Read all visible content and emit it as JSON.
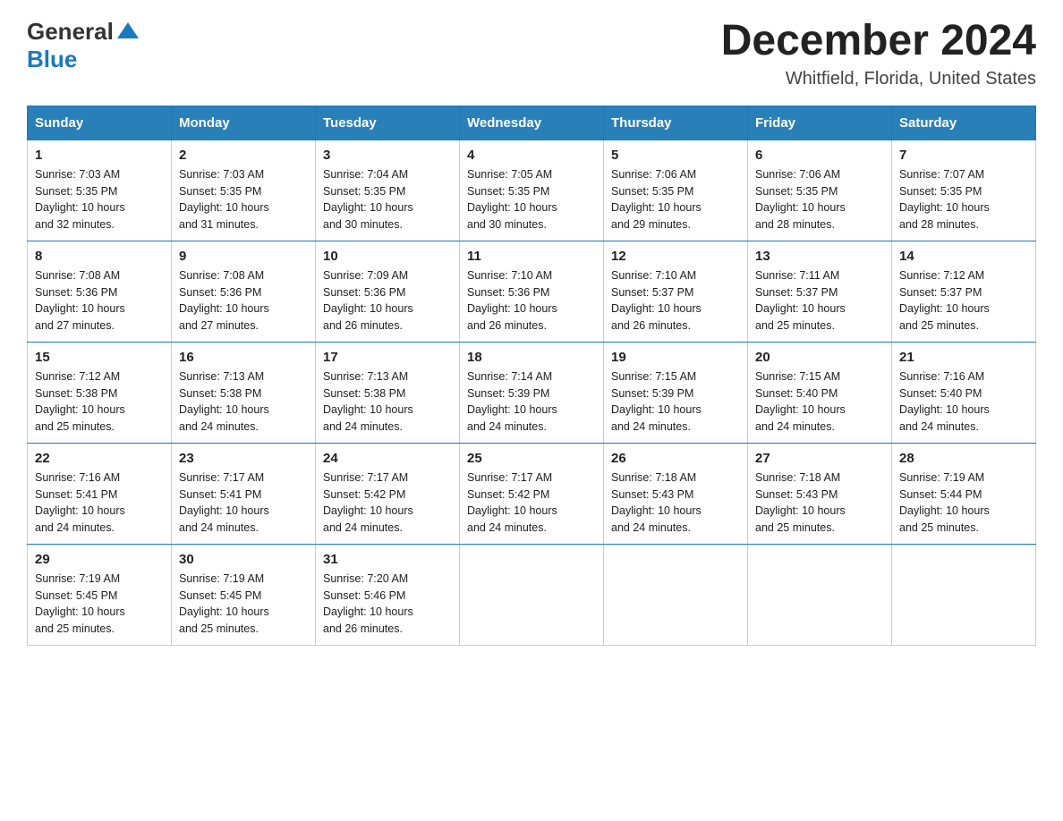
{
  "header": {
    "logo_general": "General",
    "logo_blue": "Blue",
    "month_title": "December 2024",
    "location": "Whitfield, Florida, United States"
  },
  "calendar": {
    "days_of_week": [
      "Sunday",
      "Monday",
      "Tuesday",
      "Wednesday",
      "Thursday",
      "Friday",
      "Saturday"
    ],
    "weeks": [
      [
        {
          "day": "1",
          "sunrise": "7:03 AM",
          "sunset": "5:35 PM",
          "daylight": "10 hours and 32 minutes."
        },
        {
          "day": "2",
          "sunrise": "7:03 AM",
          "sunset": "5:35 PM",
          "daylight": "10 hours and 31 minutes."
        },
        {
          "day": "3",
          "sunrise": "7:04 AM",
          "sunset": "5:35 PM",
          "daylight": "10 hours and 30 minutes."
        },
        {
          "day": "4",
          "sunrise": "7:05 AM",
          "sunset": "5:35 PM",
          "daylight": "10 hours and 30 minutes."
        },
        {
          "day": "5",
          "sunrise": "7:06 AM",
          "sunset": "5:35 PM",
          "daylight": "10 hours and 29 minutes."
        },
        {
          "day": "6",
          "sunrise": "7:06 AM",
          "sunset": "5:35 PM",
          "daylight": "10 hours and 28 minutes."
        },
        {
          "day": "7",
          "sunrise": "7:07 AM",
          "sunset": "5:35 PM",
          "daylight": "10 hours and 28 minutes."
        }
      ],
      [
        {
          "day": "8",
          "sunrise": "7:08 AM",
          "sunset": "5:36 PM",
          "daylight": "10 hours and 27 minutes."
        },
        {
          "day": "9",
          "sunrise": "7:08 AM",
          "sunset": "5:36 PM",
          "daylight": "10 hours and 27 minutes."
        },
        {
          "day": "10",
          "sunrise": "7:09 AM",
          "sunset": "5:36 PM",
          "daylight": "10 hours and 26 minutes."
        },
        {
          "day": "11",
          "sunrise": "7:10 AM",
          "sunset": "5:36 PM",
          "daylight": "10 hours and 26 minutes."
        },
        {
          "day": "12",
          "sunrise": "7:10 AM",
          "sunset": "5:37 PM",
          "daylight": "10 hours and 26 minutes."
        },
        {
          "day": "13",
          "sunrise": "7:11 AM",
          "sunset": "5:37 PM",
          "daylight": "10 hours and 25 minutes."
        },
        {
          "day": "14",
          "sunrise": "7:12 AM",
          "sunset": "5:37 PM",
          "daylight": "10 hours and 25 minutes."
        }
      ],
      [
        {
          "day": "15",
          "sunrise": "7:12 AM",
          "sunset": "5:38 PM",
          "daylight": "10 hours and 25 minutes."
        },
        {
          "day": "16",
          "sunrise": "7:13 AM",
          "sunset": "5:38 PM",
          "daylight": "10 hours and 24 minutes."
        },
        {
          "day": "17",
          "sunrise": "7:13 AM",
          "sunset": "5:38 PM",
          "daylight": "10 hours and 24 minutes."
        },
        {
          "day": "18",
          "sunrise": "7:14 AM",
          "sunset": "5:39 PM",
          "daylight": "10 hours and 24 minutes."
        },
        {
          "day": "19",
          "sunrise": "7:15 AM",
          "sunset": "5:39 PM",
          "daylight": "10 hours and 24 minutes."
        },
        {
          "day": "20",
          "sunrise": "7:15 AM",
          "sunset": "5:40 PM",
          "daylight": "10 hours and 24 minutes."
        },
        {
          "day": "21",
          "sunrise": "7:16 AM",
          "sunset": "5:40 PM",
          "daylight": "10 hours and 24 minutes."
        }
      ],
      [
        {
          "day": "22",
          "sunrise": "7:16 AM",
          "sunset": "5:41 PM",
          "daylight": "10 hours and 24 minutes."
        },
        {
          "day": "23",
          "sunrise": "7:17 AM",
          "sunset": "5:41 PM",
          "daylight": "10 hours and 24 minutes."
        },
        {
          "day": "24",
          "sunrise": "7:17 AM",
          "sunset": "5:42 PM",
          "daylight": "10 hours and 24 minutes."
        },
        {
          "day": "25",
          "sunrise": "7:17 AM",
          "sunset": "5:42 PM",
          "daylight": "10 hours and 24 minutes."
        },
        {
          "day": "26",
          "sunrise": "7:18 AM",
          "sunset": "5:43 PM",
          "daylight": "10 hours and 24 minutes."
        },
        {
          "day": "27",
          "sunrise": "7:18 AM",
          "sunset": "5:43 PM",
          "daylight": "10 hours and 25 minutes."
        },
        {
          "day": "28",
          "sunrise": "7:19 AM",
          "sunset": "5:44 PM",
          "daylight": "10 hours and 25 minutes."
        }
      ],
      [
        {
          "day": "29",
          "sunrise": "7:19 AM",
          "sunset": "5:45 PM",
          "daylight": "10 hours and 25 minutes."
        },
        {
          "day": "30",
          "sunrise": "7:19 AM",
          "sunset": "5:45 PM",
          "daylight": "10 hours and 25 minutes."
        },
        {
          "day": "31",
          "sunrise": "7:20 AM",
          "sunset": "5:46 PM",
          "daylight": "10 hours and 26 minutes."
        },
        null,
        null,
        null,
        null
      ]
    ],
    "labels": {
      "sunrise": "Sunrise:",
      "sunset": "Sunset:",
      "daylight": "Daylight:"
    }
  }
}
